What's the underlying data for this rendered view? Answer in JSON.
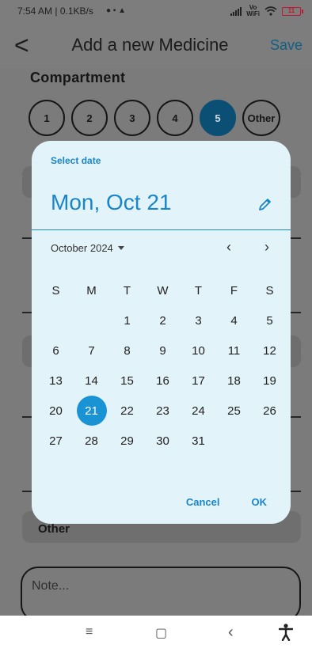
{
  "status_bar": {
    "left_text": "7:54 AM | 0.1KB/s",
    "vowifi_top": "Vo",
    "vowifi_bottom": "WiFi",
    "battery": "11"
  },
  "app_bar": {
    "back": "<",
    "title": "Add a new Medicine",
    "save": "Save"
  },
  "form": {
    "compartment_label": "Compartment",
    "compartments": [
      "1",
      "2",
      "3",
      "4",
      "5",
      "Other"
    ],
    "selected_compartment": "5",
    "other_label": "Other",
    "note_placeholder": "Note..."
  },
  "date_picker": {
    "header": "Select date",
    "selected_display": "Mon, Oct 21",
    "month_label": "October 2024",
    "weekdays": [
      "S",
      "M",
      "T",
      "W",
      "T",
      "F",
      "S"
    ],
    "leading_blanks": 2,
    "days_in_month": 31,
    "selected_day": 21,
    "cancel": "Cancel",
    "ok": "OK"
  },
  "nav_bar": {
    "menu": "≡",
    "home": "▢",
    "back": "‹",
    "accessibility": "accessibility-icon"
  }
}
